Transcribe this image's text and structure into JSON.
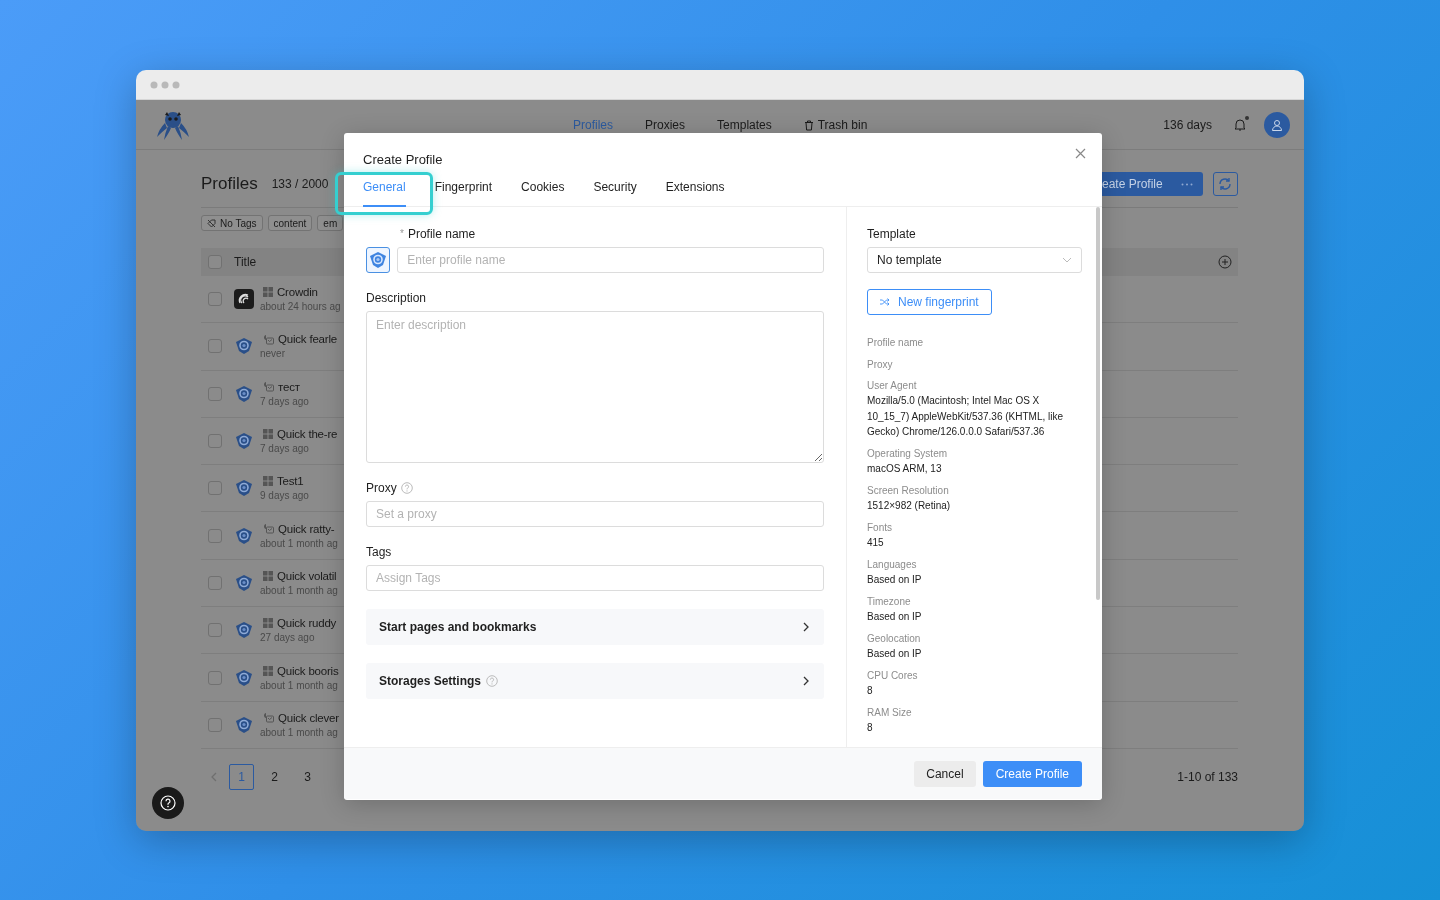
{
  "header": {
    "nav": [
      {
        "label": "Profiles",
        "selected": true
      },
      {
        "label": "Proxies",
        "selected": false
      },
      {
        "label": "Templates",
        "selected": false
      },
      {
        "label": "Trash bin",
        "selected": false,
        "kind": "trash"
      }
    ],
    "days": "136 days",
    "notification": true
  },
  "page": {
    "title": "Profiles",
    "count": "133 / 2000",
    "create_button": "eate Profile",
    "tags": [
      {
        "label": "No Tags",
        "kind": "none"
      },
      {
        "label": "content",
        "kind": "tag"
      },
      {
        "label": "em",
        "kind": "tag"
      }
    ],
    "table": {
      "columns": [
        "Title"
      ],
      "all_checked": false,
      "rows": [
        {
          "name": "Crowdin",
          "time": "about 24 hours ag",
          "platform": {
            "kind": "windows"
          },
          "kind": "app",
          "checked": false
        },
        {
          "name": "Quick fearle",
          "time": "never",
          "platform": {
            "kind": "mac"
          },
          "kind": "browser",
          "checked": false
        },
        {
          "name": "тест",
          "time": "7 days ago",
          "platform": {
            "kind": "mac"
          },
          "kind": "browser",
          "checked": false
        },
        {
          "name": "Quick the-re",
          "time": "7 days ago",
          "platform": {
            "kind": "windows"
          },
          "kind": "browser",
          "checked": false
        },
        {
          "name": "Test1",
          "time": "9 days ago",
          "platform": {
            "kind": "windows"
          },
          "kind": "browser",
          "checked": false
        },
        {
          "name": "Quick ratty-",
          "time": "about 1 month ag",
          "platform": {
            "kind": "mac"
          },
          "kind": "browser",
          "checked": false
        },
        {
          "name": "Quick volatil",
          "time": "about 1 month ag",
          "platform": {
            "kind": "windows"
          },
          "kind": "browser",
          "checked": false
        },
        {
          "name": "Quick ruddy",
          "time": "27 days ago",
          "platform": {
            "kind": "windows"
          },
          "kind": "browser",
          "checked": false
        },
        {
          "name": "Quick booris",
          "time": "about 1 month ag",
          "platform": {
            "kind": "windows"
          },
          "kind": "browser",
          "checked": false
        },
        {
          "name": "Quick clever",
          "time": "about 1 month ag",
          "platform": {
            "kind": "mac"
          },
          "kind": "browser",
          "checked": false
        }
      ]
    },
    "pagination": {
      "pages": [
        {
          "label": "1",
          "selected": true
        },
        {
          "label": "2",
          "selected": false
        },
        {
          "label": "3",
          "selected": false
        }
      ],
      "range": "1-10 of 133"
    }
  },
  "modal": {
    "title": "Create Profile",
    "tabs": [
      {
        "label": "General",
        "selected": true,
        "highlighted": true
      },
      {
        "label": "Fingerprint",
        "selected": false,
        "highlighted": false
      },
      {
        "label": "Cookies",
        "selected": false,
        "highlighted": false
      },
      {
        "label": "Security",
        "selected": false,
        "highlighted": false
      },
      {
        "label": "Extensions",
        "selected": false,
        "highlighted": false
      }
    ],
    "fields": [
      {
        "kind": "name",
        "marker": "*",
        "label": "Profile name",
        "placeholder": "Enter profile name",
        "help": false
      },
      {
        "kind": "textarea",
        "label": "Description",
        "placeholder": "Enter description",
        "help": false
      },
      {
        "kind": "input",
        "label": "Proxy",
        "placeholder": "Set a proxy",
        "help": true
      },
      {
        "kind": "input",
        "label": "Tags",
        "placeholder": "Assign Tags",
        "help": false
      }
    ],
    "sections": [
      {
        "label": "Start pages and bookmarks",
        "help": false
      },
      {
        "label": "Storages Settings",
        "help": true
      }
    ],
    "template": {
      "label": "Template",
      "value": "No template"
    },
    "fingerprint_button": "New fingerprint",
    "details": [
      {
        "label": "Profile name"
      },
      {
        "label": "Proxy"
      },
      {
        "label": "User Agent",
        "value": "Mozilla/5.0 (Macintosh; Intel Mac OS X 10_15_7) AppleWebKit/537.36 (KHTML, like Gecko) Chrome/126.0.0.0 Safari/537.36"
      },
      {
        "label": "Operating System",
        "value": "macOS ARM, 13"
      },
      {
        "label": "Screen Resolution",
        "value": "1512×982 (Retina)"
      },
      {
        "label": "Fonts",
        "value": "415"
      },
      {
        "label": "Languages",
        "value": "Based on IP"
      },
      {
        "label": "Timezone",
        "value": "Based on IP"
      },
      {
        "label": "Geolocation",
        "value": "Based on IP"
      },
      {
        "label": "CPU Cores",
        "value": "8"
      },
      {
        "label": "RAM Size",
        "value": "8"
      }
    ],
    "buttons": [
      {
        "label": "Cancel",
        "kind": "secondary"
      },
      {
        "label": "Create Profile",
        "kind": "primary"
      }
    ]
  }
}
